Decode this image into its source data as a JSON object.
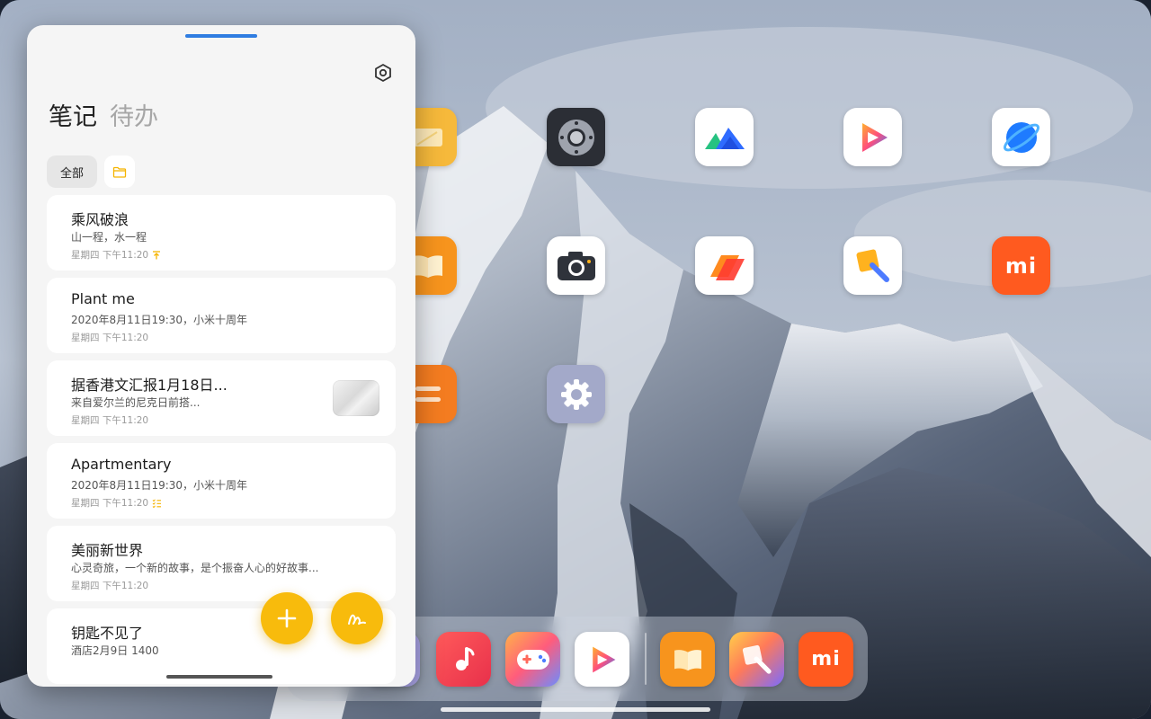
{
  "notes_panel": {
    "tabs": [
      {
        "label": "笔记",
        "active": true
      },
      {
        "label": "待办",
        "active": false
      }
    ],
    "filters": {
      "all_label": "全部"
    },
    "notes": [
      {
        "title": "乘风破浪",
        "subtitle": "山一程，水一程",
        "time": "星期四 下午11:20",
        "marker": "pin"
      },
      {
        "title": "Plant me",
        "subtitle": "2020年8月11日19:30，小米十周年",
        "time": "星期四 下午11:20",
        "marker": ""
      },
      {
        "title": "据香港文汇报1月18日...",
        "subtitle": "来自爱尔兰的尼克日前搭...",
        "time": "星期四 下午11:20",
        "marker": "",
        "has_thumbnail": true
      },
      {
        "title": "Apartmentary",
        "subtitle": "2020年8月11日19:30，小米十周年",
        "time": "星期四 下午11:20",
        "marker": "checklist"
      },
      {
        "title": "美丽新世界",
        "subtitle": "心灵奇旅，一个新的故事，是个振奋人心的好故事...",
        "time": "星期四 下午11:20",
        "marker": ""
      },
      {
        "title": "钥匙不见了",
        "subtitle": "酒店2月9日 1400",
        "time": "",
        "marker": ""
      }
    ],
    "accent_color": "#f8bb0c"
  },
  "home_screen": {
    "apps": [
      {
        "icon": "notes-app-icon"
      },
      {
        "icon": "remote-app-icon"
      },
      {
        "icon": "mountain-app-icon"
      },
      {
        "icon": "video-player-app-icon"
      },
      {
        "icon": "browser-app-icon"
      },
      {
        "icon": "books-app-icon"
      },
      {
        "icon": "camera-app-icon"
      },
      {
        "icon": "cards-app-icon"
      },
      {
        "icon": "themes-app-icon"
      },
      {
        "icon": "mi-store-app-icon"
      },
      {
        "icon": "tasks-app-icon"
      },
      {
        "icon": "settings-app-icon"
      }
    ],
    "dock": [
      {
        "icon": "partial-app-icon"
      },
      {
        "icon": "music-app-icon"
      },
      {
        "icon": "game-center-app-icon"
      },
      {
        "icon": "video-player-app-icon"
      },
      {
        "icon": "books-app-icon"
      },
      {
        "icon": "themes-app-icon"
      },
      {
        "icon": "mi-store-app-icon"
      }
    ],
    "dock_mi_label": "mi",
    "app_mi_label": "mi"
  }
}
